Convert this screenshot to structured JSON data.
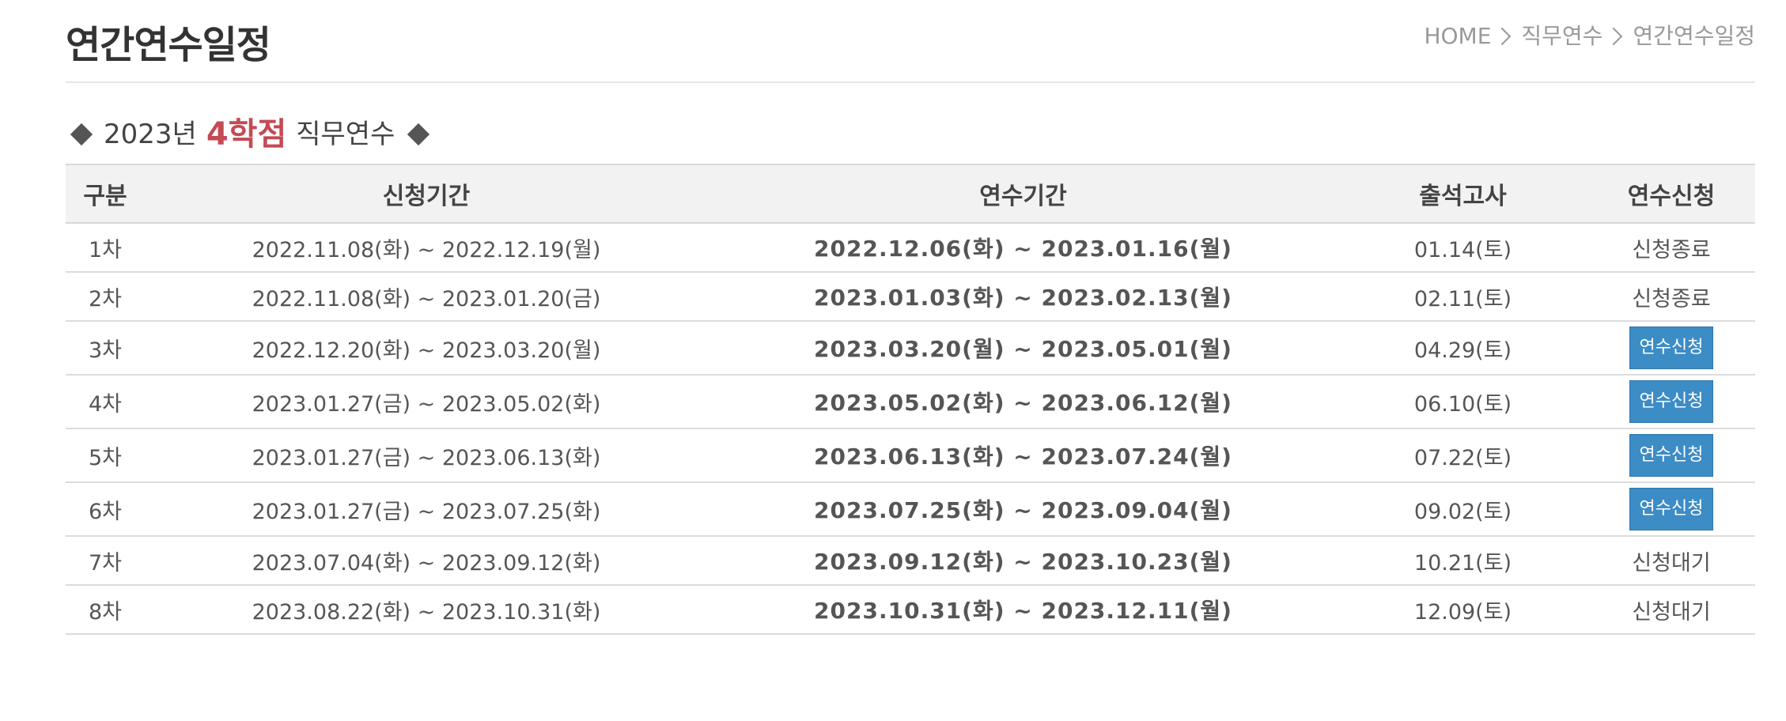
{
  "header": {
    "title": "연간연수일정",
    "breadcrumb": [
      "HOME",
      "직무연수",
      "연간연수일정"
    ]
  },
  "section": {
    "prefix": "2023년",
    "highlight": "4학점",
    "suffix": "직무연수"
  },
  "colors": {
    "accent_red": "#c44a54",
    "button_blue": "#3c8cc6",
    "header_bg": "#f2f2f2"
  },
  "table": {
    "columns": [
      "구분",
      "신청기간",
      "연수기간",
      "출석고사",
      "연수신청"
    ],
    "rows": [
      {
        "round": "1차",
        "apply": "2022.11.08(화) ~ 2022.12.19(월)",
        "period": "2022.12.06(화) ~ 2023.01.16(월)",
        "exam": "01.14(토)",
        "status": "신청종료",
        "button": false
      },
      {
        "round": "2차",
        "apply": "2022.11.08(화) ~ 2023.01.20(금)",
        "period": "2023.01.03(화) ~ 2023.02.13(월)",
        "exam": "02.11(토)",
        "status": "신청종료",
        "button": false
      },
      {
        "round": "3차",
        "apply": "2022.12.20(화) ~ 2023.03.20(월)",
        "period": "2023.03.20(월) ~ 2023.05.01(월)",
        "exam": "04.29(토)",
        "status": "연수신청",
        "button": true
      },
      {
        "round": "4차",
        "apply": "2023.01.27(금) ~ 2023.05.02(화)",
        "period": "2023.05.02(화) ~ 2023.06.12(월)",
        "exam": "06.10(토)",
        "status": "연수신청",
        "button": true
      },
      {
        "round": "5차",
        "apply": "2023.01.27(금) ~ 2023.06.13(화)",
        "period": "2023.06.13(화) ~ 2023.07.24(월)",
        "exam": "07.22(토)",
        "status": "연수신청",
        "button": true
      },
      {
        "round": "6차",
        "apply": "2023.01.27(금) ~ 2023.07.25(화)",
        "period": "2023.07.25(화) ~ 2023.09.04(월)",
        "exam": "09.02(토)",
        "status": "연수신청",
        "button": true
      },
      {
        "round": "7차",
        "apply": "2023.07.04(화) ~ 2023.09.12(화)",
        "period": "2023.09.12(화) ~ 2023.10.23(월)",
        "exam": "10.21(토)",
        "status": "신청대기",
        "button": false
      },
      {
        "round": "8차",
        "apply": "2023.08.22(화) ~ 2023.10.31(화)",
        "period": "2023.10.31(화) ~ 2023.12.11(월)",
        "exam": "12.09(토)",
        "status": "신청대기",
        "button": false
      }
    ]
  }
}
